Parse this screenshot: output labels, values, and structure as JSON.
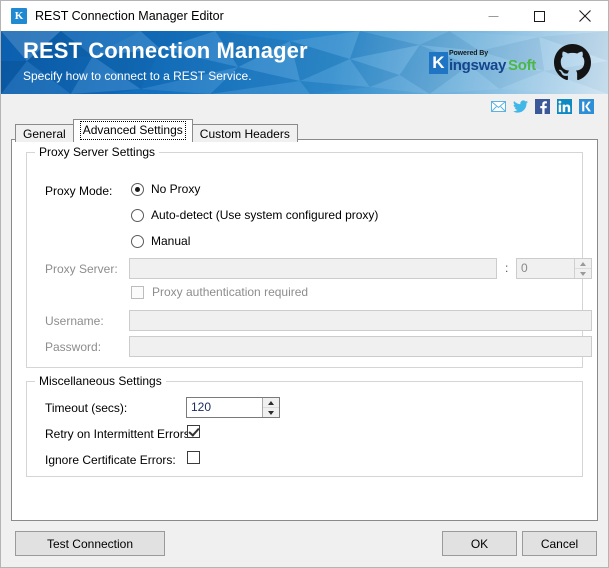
{
  "window": {
    "title": "REST Connection Manager Editor",
    "icon": "K",
    "controls": {
      "minimize": "minimize-icon",
      "maximize": "maximize-icon",
      "close": "close-icon"
    }
  },
  "banner": {
    "title": "REST Connection Manager",
    "subtitle": "Specify how to connect to a REST Service.",
    "logo": {
      "k": "K",
      "powered_by": "Powered By",
      "ingsway": "ingsway",
      "soft": "Soft"
    },
    "github_icon": "github-icon",
    "colors": {
      "blue_dark": "#0b5fae",
      "blue_mid": "#2f8ccd",
      "blue_light": "#cfe4f2",
      "kws_blue": "#1f74c4",
      "kws_navy": "#15458c",
      "kws_green": "#4cb748"
    }
  },
  "social": {
    "items": [
      {
        "icon": "email-icon"
      },
      {
        "icon": "twitter-icon"
      },
      {
        "icon": "facebook-icon"
      },
      {
        "icon": "linkedin-icon"
      },
      {
        "icon": "kingswaysoft-icon"
      }
    ]
  },
  "tabs": [
    {
      "label": "General",
      "selected": false
    },
    {
      "label": "Advanced Settings",
      "selected": true
    },
    {
      "label": "Custom Headers",
      "selected": false
    }
  ],
  "proxy_group": {
    "title": "Proxy Server Settings",
    "proxy_mode_label": "Proxy Mode:",
    "options": [
      {
        "label": "No Proxy",
        "checked": true
      },
      {
        "label": "Auto-detect (Use system configured proxy)",
        "checked": false
      },
      {
        "label": "Manual",
        "checked": false
      }
    ],
    "proxy_server_label": "Proxy Server:",
    "proxy_server_value": "",
    "colon": ":",
    "port_value": "0",
    "auth_required_label": "Proxy authentication required",
    "auth_required_checked": false,
    "username_label": "Username:",
    "username_value": "",
    "password_label": "Password:",
    "password_value": ""
  },
  "misc_group": {
    "title": "Miscellaneous Settings",
    "timeout_label": "Timeout (secs):",
    "timeout_value": "120",
    "retry_label": "Retry on Intermittent Errors:",
    "retry_checked": true,
    "ignore_cert_label": "Ignore Certificate Errors:",
    "ignore_cert_checked": false
  },
  "footer": {
    "test_connection": "Test Connection",
    "ok": "OK",
    "cancel": "Cancel"
  }
}
